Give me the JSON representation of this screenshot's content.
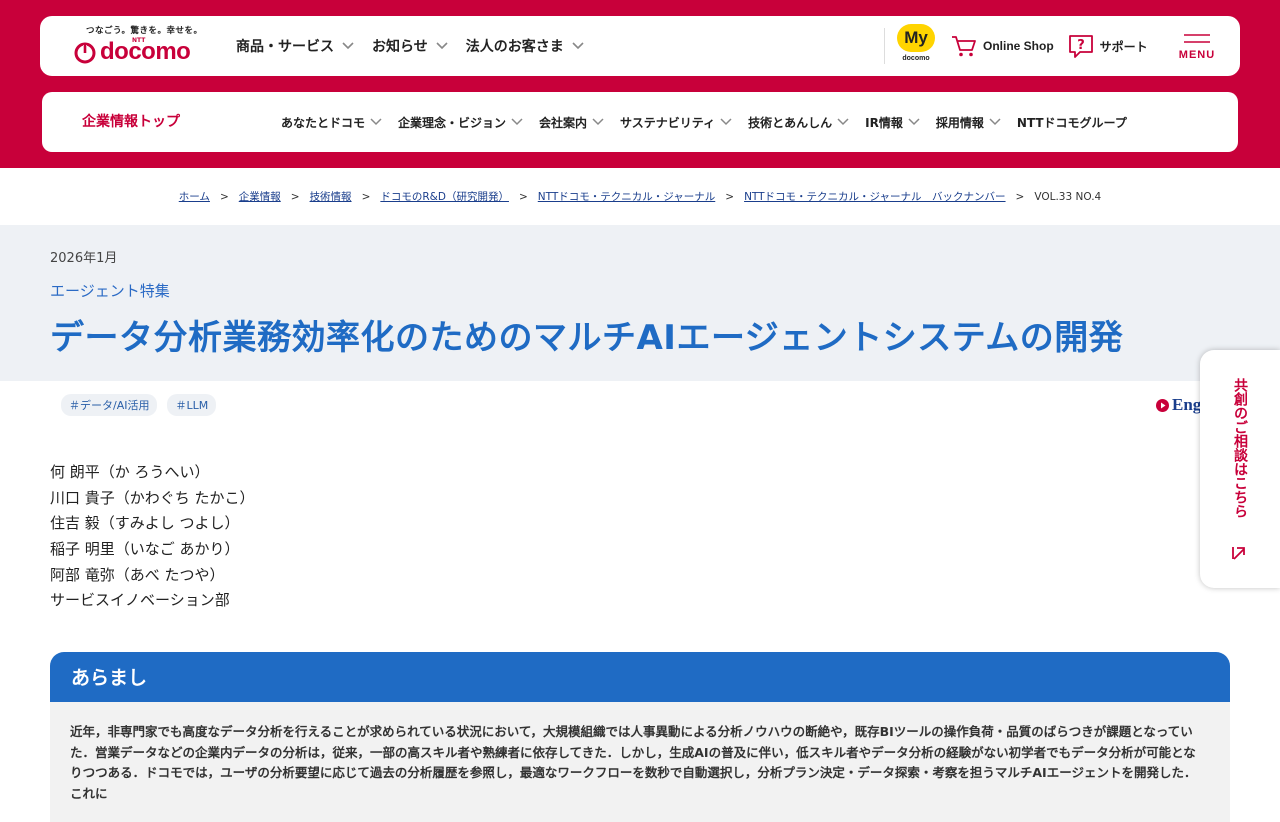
{
  "header": {
    "logo_tagline": "つなごう。驚きを。幸せを。",
    "logo_ntt": "NTT",
    "logo_text": "docomo",
    "nav": [
      "商品・サービス",
      "お知らせ",
      "法人のお客さま"
    ],
    "my_label": "My",
    "my_sub": "docomo",
    "online_shop": "Online Shop",
    "support": "サポート",
    "menu": "MENU",
    "accent_color": "#c8003a"
  },
  "subnav": {
    "title": "企業情報トップ",
    "items": [
      "あなたとドコモ",
      "企業理念・ビジョン",
      "会社案内",
      "サステナビリティ",
      "技術とあんしん",
      "IR情報",
      "採用情報",
      "NTTドコモグループ"
    ]
  },
  "breadcrumb": {
    "links": [
      "ホーム",
      "企業情報",
      "技術情報",
      "ドコモのR&D（研究開発）",
      "NTTドコモ・テクニカル・ジャーナル",
      "NTTドコモ・テクニカル・ジャーナル　バックナンバー"
    ],
    "current": "VOL.33 NO.4",
    "separator": ">"
  },
  "article": {
    "date": "2026年1月",
    "feature": "エージェント特集",
    "title": "データ分析業務効率化のためのマルチAIエージェントシステムの開発",
    "tags": [
      "＃データ/AI活用",
      "＃LLM"
    ],
    "english_link": "Eng",
    "authors": [
      "何 朗平（か ろうへい）",
      "川口 貴子（かわぐち たかこ）",
      "住吉 毅（すみよし つよし）",
      "稲子 明里（いなご あかり）",
      "阿部 竜弥（あべ たつや）",
      "サービスイノベーション部"
    ]
  },
  "consult": {
    "label": "共創のご相談はこちら"
  },
  "summary": {
    "heading": "あらまし",
    "text": "近年，非専門家でも高度なデータ分析を行えることが求められている状況において，大規模組織では人事異動による分析ノウハウの断絶や，既存BIツールの操作負荷・品質のばらつきが課題となっていた．営業データなどの企業内データの分析は，従来，一部の高スキル者や熟練者に依存してきた．しかし，生成AIの普及に伴い，低スキル者やデータ分析の経験がない初学者でもデータ分析が可能となりつつある．ドコモでは，ユーザの分析要望に応じて過去の分析履歴を参照し，最適なワークフローを数秒で自動選択し，分析プラン決定・データ探索・考察を担うマルチAIエージェントを開発した．これに"
  }
}
